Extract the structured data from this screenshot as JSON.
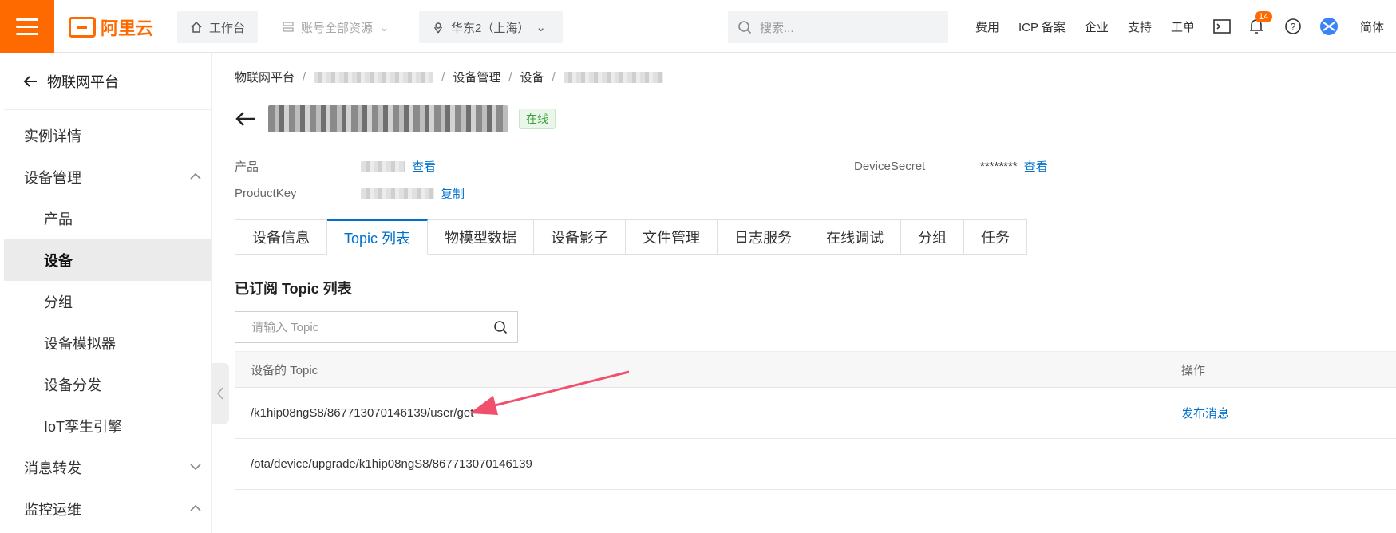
{
  "header": {
    "logo_text": "阿里云",
    "workbench": "工作台",
    "resources": "账号全部资源",
    "region": "华东2（上海）",
    "search_placeholder": "搜索...",
    "links": [
      "费用",
      "ICP 备案",
      "企业",
      "支持",
      "工单"
    ],
    "notification_count": "14",
    "language": "简体",
    "accent_color": "#ff6a00"
  },
  "sidebar": {
    "back_label": "物联网平台",
    "items": [
      {
        "label": "实例详情",
        "level": 0
      },
      {
        "label": "设备管理",
        "level": 0,
        "expanded": true
      },
      {
        "label": "产品",
        "level": 1
      },
      {
        "label": "设备",
        "level": 1,
        "active": true
      },
      {
        "label": "分组",
        "level": 1
      },
      {
        "label": "设备模拟器",
        "level": 1
      },
      {
        "label": "设备分发",
        "level": 1
      },
      {
        "label": "IoT孪生引擎",
        "level": 1
      },
      {
        "label": "消息转发",
        "level": 0,
        "expanded": false
      },
      {
        "label": "监控运维",
        "level": 0,
        "expanded": true
      }
    ]
  },
  "breadcrumb": [
    "物联网平台",
    "设备管理",
    "设备"
  ],
  "device": {
    "status": "在线",
    "product_label": "产品",
    "product_link": "查看",
    "productkey_label": "ProductKey",
    "productkey_link": "复制",
    "secret_label": "DeviceSecret",
    "secret_value": "********",
    "secret_link": "查看"
  },
  "tabs": [
    "设备信息",
    "Topic 列表",
    "物模型数据",
    "设备影子",
    "文件管理",
    "日志服务",
    "在线调试",
    "分组",
    "任务"
  ],
  "active_tab": "Topic 列表",
  "topics": {
    "section_title": "已订阅 Topic 列表",
    "search_placeholder": "请输入 Topic",
    "columns": [
      "设备的 Topic",
      "操作"
    ],
    "rows": [
      {
        "topic": "/k1hip08ngS8/867713070146139/user/get",
        "action": "发布消息"
      },
      {
        "topic": "/ota/device/upgrade/k1hip08ngS8/867713070146139",
        "action": ""
      }
    ]
  }
}
